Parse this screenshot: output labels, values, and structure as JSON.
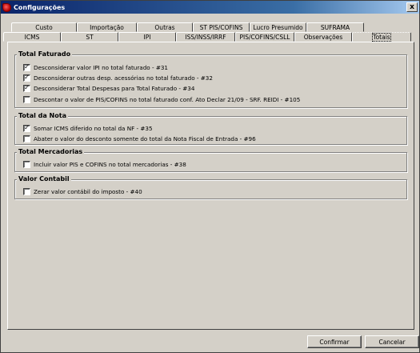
{
  "window": {
    "title": "Configurações",
    "close_glyph": "x"
  },
  "tabs": {
    "row1": [
      "Custo",
      "Importação",
      "Outras",
      "ST PIS/COFINS",
      "Lucro Presumido",
      "SUFRAMA"
    ],
    "row2": [
      "ICMS",
      "ST",
      "IPI",
      "ISS/INSS/IRRF",
      "PIS/COFINS/CSLL",
      "Observações",
      "Totais"
    ],
    "active": "Totais"
  },
  "groups": {
    "total_faturado": {
      "title": "Total Faturado",
      "items": [
        {
          "label": "Desconsiderar valor IPI no total faturado - #31",
          "checked": true
        },
        {
          "label": "Desconsiderar outras desp. acessórias no total faturado - #32",
          "checked": true
        },
        {
          "label": "Desconsiderar Total Despesas para Total Faturado - #34",
          "checked": true
        },
        {
          "label": "Descontar o valor de PIS/COFINS no total faturado conf. Ato Declar 21/09 - SRF. REIDI - #105",
          "checked": false
        }
      ]
    },
    "total_nota": {
      "title": "Total da Nota",
      "items": [
        {
          "label": "Somar ICMS diferido no total da NF - #35",
          "checked": true
        },
        {
          "label": "Abater o valor do desconto somente do total da Nota Fiscal de Entrada - #96",
          "checked": false
        }
      ]
    },
    "total_mercadorias": {
      "title": "Total Mercadorias",
      "items": [
        {
          "label": "Incluir valor PIS e COFINS no total mercadorias - #38",
          "checked": false
        }
      ]
    },
    "valor_contabil": {
      "title": "Valor Contabil",
      "items": [
        {
          "label": "Zerar valor contábil do imposto - #40",
          "checked": false
        }
      ]
    }
  },
  "buttons": {
    "confirm": "Confirmar",
    "cancel": "Cancelar"
  },
  "check_glyph": "✓"
}
